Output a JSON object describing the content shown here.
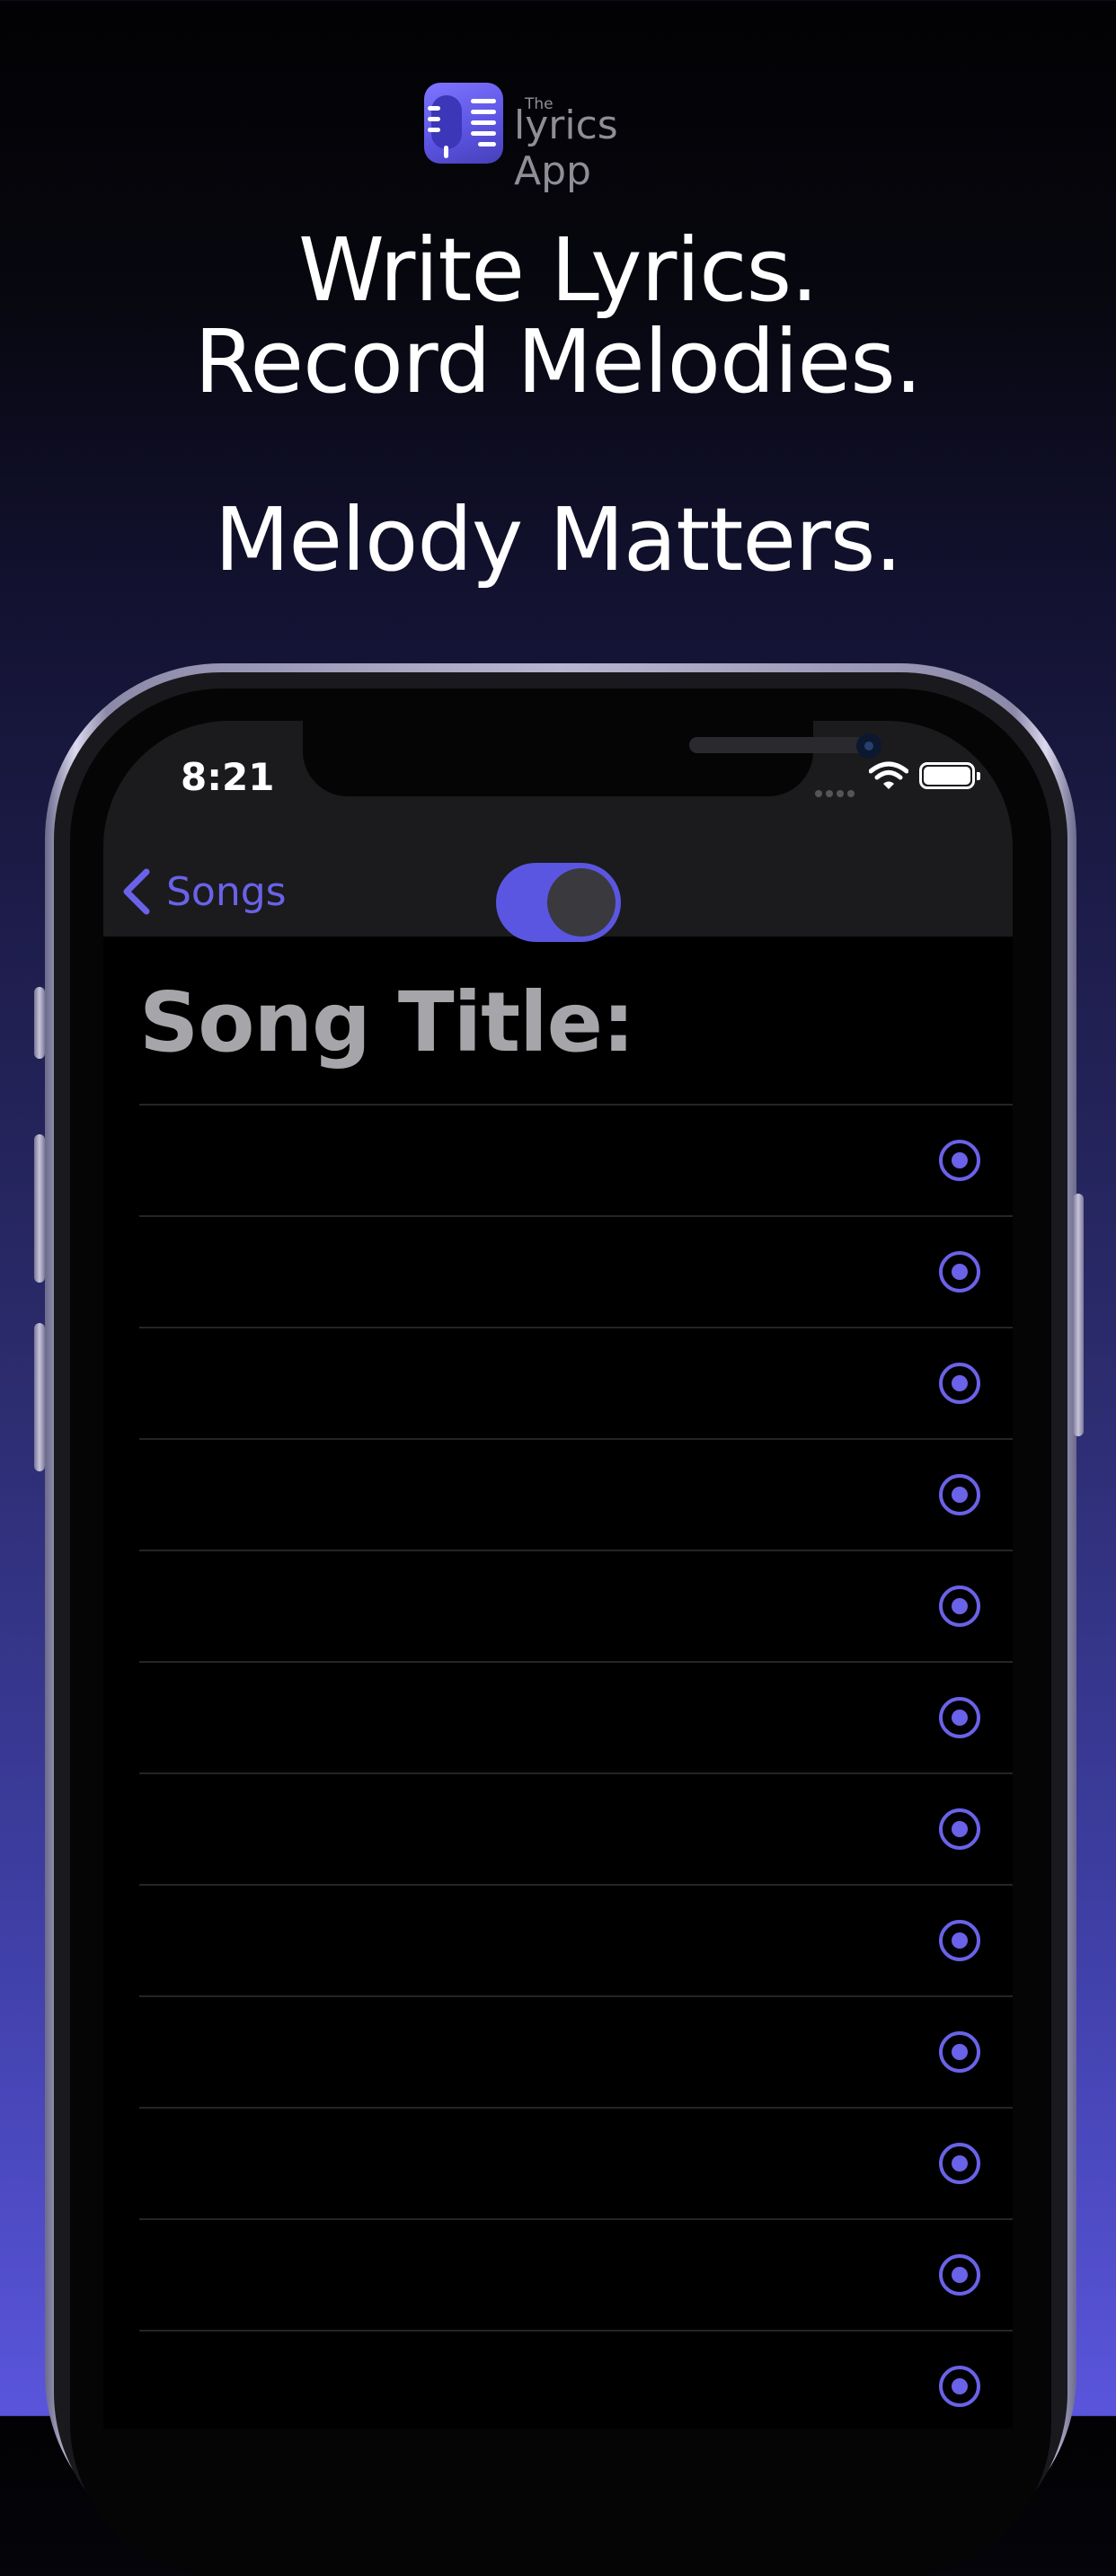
{
  "brand": {
    "the": "The",
    "word": "lyrics App"
  },
  "headline": {
    "line1": "Write Lyrics.",
    "line2": "Record Melodies.",
    "line3": "Melody Matters."
  },
  "status": {
    "time": "8:21"
  },
  "nav": {
    "back_label": "Songs",
    "toggle_on": true
  },
  "content": {
    "title_label": "Song Title:"
  },
  "rows": [
    {
      "icon": "record-icon"
    },
    {
      "icon": "record-icon"
    },
    {
      "icon": "record-icon"
    },
    {
      "icon": "record-icon"
    },
    {
      "icon": "record-icon"
    },
    {
      "icon": "record-icon"
    },
    {
      "icon": "record-icon"
    },
    {
      "icon": "record-icon"
    },
    {
      "icon": "record-icon"
    },
    {
      "icon": "record-icon"
    },
    {
      "icon": "record-icon"
    },
    {
      "icon": "record-icon"
    }
  ],
  "colors": {
    "accent": "#6a62e8",
    "toggle": "#5b56e1",
    "title": "#a6a6aa",
    "bar": "#1b1b1d"
  }
}
